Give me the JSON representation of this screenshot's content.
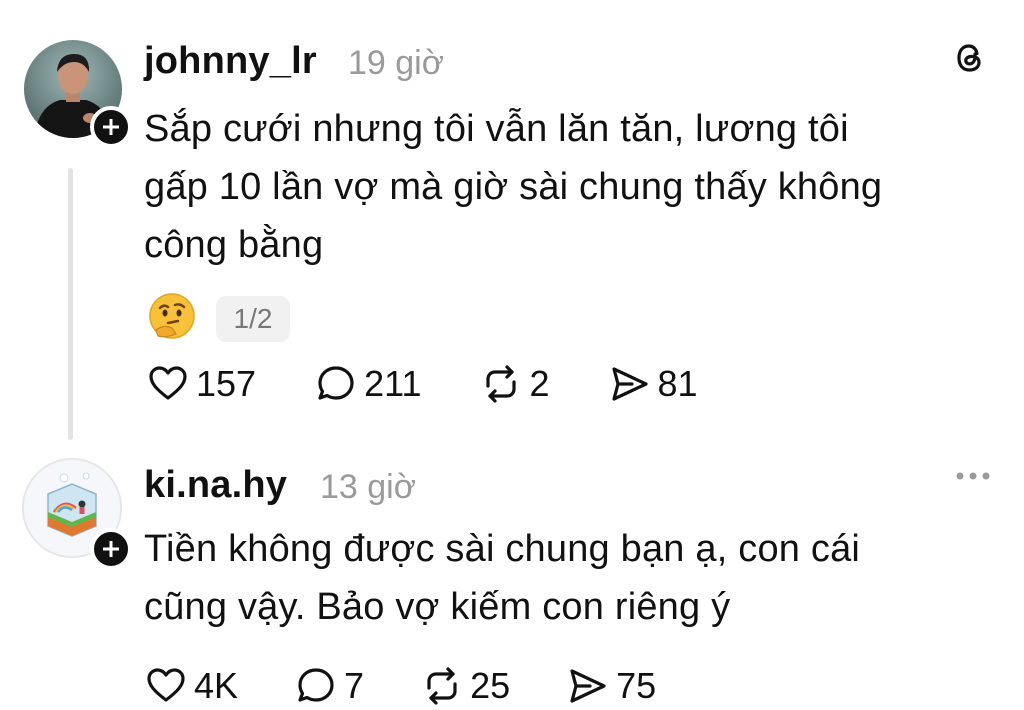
{
  "app": {
    "logo_icon": "threads-logo-icon"
  },
  "posts": [
    {
      "username": "johnny_lr",
      "time": "19 giờ",
      "text_lines": [
        "Sắp cưới nhưng tôi vẫn lăn tăn, lương tôi",
        "gấp 10 lần vợ mà giờ sài chung thấy không",
        "công bằng"
      ],
      "reaction_emoji": "🤔",
      "pager": "1/2",
      "likes": "157",
      "comments": "211",
      "reposts": "2",
      "shares": "81"
    },
    {
      "username": "ki.na.hy",
      "time": "13 giờ",
      "more_icon": "more-dots-icon",
      "text_lines": [
        "Tiền không được sài chung bạn ạ, con cái",
        "cũng vậy. Bảo vợ kiếm con riêng ý"
      ],
      "likes": "4K",
      "comments": "7",
      "reposts": "25",
      "shares": "75"
    }
  ],
  "colors": {
    "text": "#111111",
    "muted": "#9a9a9a",
    "thread_line": "#e3e3e3",
    "background": "#ffffff"
  }
}
